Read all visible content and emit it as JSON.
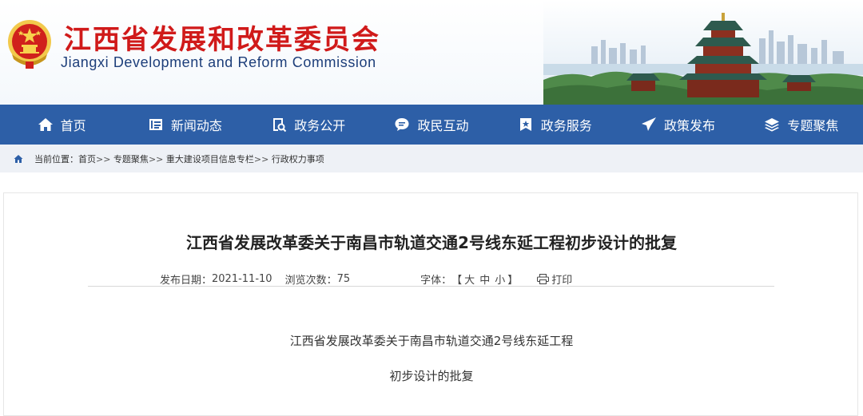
{
  "header": {
    "title": "江西省发展和改革委员会",
    "subtitle": "Jiangxi Development and Reform Commission",
    "emblem_icon": "national-emblem-icon"
  },
  "nav": [
    {
      "label": "首页",
      "icon": "home-icon"
    },
    {
      "label": "新闻动态",
      "icon": "news-icon"
    },
    {
      "label": "政务公开",
      "icon": "search-doc-icon"
    },
    {
      "label": "政民互动",
      "icon": "chat-icon"
    },
    {
      "label": "政务服务",
      "icon": "bookmark-icon"
    },
    {
      "label": "政策发布",
      "icon": "send-icon"
    },
    {
      "label": "专题聚焦",
      "icon": "layers-icon"
    }
  ],
  "breadcrumb": {
    "prefix": "当前位置：",
    "items": [
      "首页",
      "专题聚焦",
      "重大建设项目信息专栏",
      "行政权力事项"
    ],
    "separator": ">>"
  },
  "article": {
    "title": "江西省发展改革委关于南昌市轨道交通2号线东延工程初步设计的批复",
    "meta": {
      "date_label": "发布日期：",
      "date": "2021-11-10",
      "views_label": "浏览次数：",
      "views": "75",
      "font_label": "字体：",
      "font_open": "【",
      "font_large": "大",
      "font_medium": "中",
      "font_small": "小",
      "font_close": "】",
      "print_label": "打印"
    },
    "body_lines": [
      "江西省发展改革委关于南昌市轨道交通2号线东延工程",
      "初步设计的批复"
    ]
  },
  "colors": {
    "nav_bg": "#2d5fa7",
    "title_red": "#d01a1a",
    "subtitle_blue": "#1d3e7a",
    "crumb_bg": "#eef1f6"
  }
}
